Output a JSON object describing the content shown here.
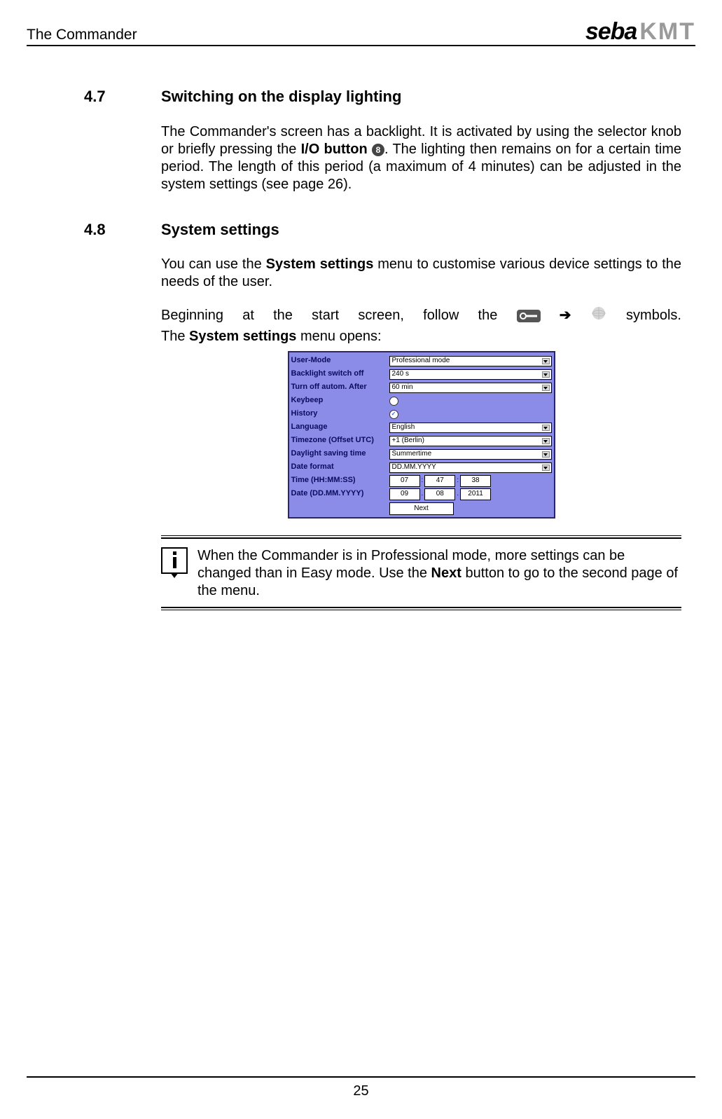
{
  "header": {
    "title": "The Commander",
    "brand_a": "seba",
    "brand_b": "KMT"
  },
  "sec47": {
    "num": "4.7",
    "title": "Switching on the display lighting",
    "p1a": "The Commander's screen has a backlight. It is activated by using the selector knob or briefly pressing the ",
    "p1b": "I/O button",
    "circ": "8",
    "p1c": ". The lighting then remains on for a certain time period. The length of this period (a maximum of 4 minutes) can be adjusted in the system settings (see page 26)."
  },
  "sec48": {
    "num": "4.8",
    "title": "System settings",
    "p1a": "You can use the ",
    "p1b": "System settings",
    "p1c": " menu to customise various device settings to the needs of the user.",
    "j": {
      "w1": "Beginning",
      "w2": "at",
      "w3": "the",
      "w4": "start",
      "w5": "screen,",
      "w6": "follow",
      "w7": "the",
      "arrow": "➔",
      "w8": "symbols."
    },
    "p3a": "The ",
    "p3b": "System settings",
    "p3c": " menu opens:"
  },
  "device": {
    "rows": {
      "r0": {
        "label": "User-Mode",
        "value": "Professional mode"
      },
      "r1": {
        "label": "Backlight switch off",
        "value": "240 s"
      },
      "r2": {
        "label": "Turn off autom. After",
        "value": "60 min"
      },
      "r3": {
        "label": "Keybeep"
      },
      "r4": {
        "label": "History",
        "check": "✓"
      },
      "r5": {
        "label": "Language",
        "value": "English"
      },
      "r6": {
        "label": "Timezone (Offset UTC)",
        "value": "+1    (Berlin)"
      },
      "r7": {
        "label": "Daylight saving time",
        "value": "Summertime"
      },
      "r8": {
        "label": "Date format",
        "value": "DD.MM.YYYY"
      },
      "r9": {
        "label": "Time (HH:MM:SS)",
        "a": "07",
        "b": "47",
        "c": "38",
        "sep": ":"
      },
      "r10": {
        "label": "Date (DD.MM.YYYY)",
        "a": "09",
        "b": "08",
        "c": "2011",
        "sep": "."
      }
    },
    "next": "Next"
  },
  "info": {
    "t1": "When the Commander is in Professional mode, more settings can be changed than in Easy mode. Use the ",
    "t2": "Next",
    "t3": " button to go to the second page of the menu."
  },
  "footer": {
    "page": "25"
  }
}
